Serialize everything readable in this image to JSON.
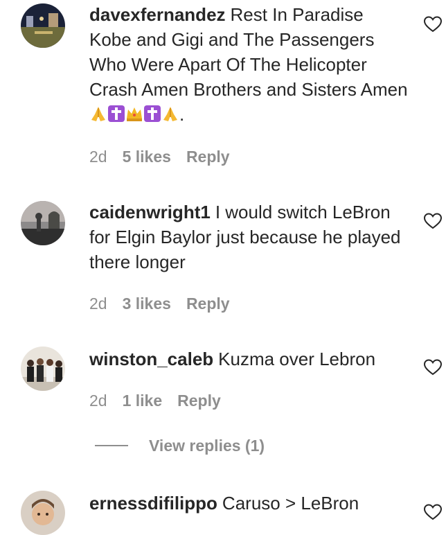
{
  "comments": [
    {
      "username": "davexfernandez",
      "text": "Rest In Paradise Kobe and Gigi and The Passengers Who Were Apart Of The Helicopter Crash Amen Brothers and Sisters Amen",
      "emoji_suffix": [
        "folded-hands",
        "latin-cross",
        "crown",
        "latin-cross",
        "folded-hands"
      ],
      "text_end": ".",
      "time": "2d",
      "likes": "5 likes",
      "reply": "Reply"
    },
    {
      "username": "caidenwright1",
      "text": "I would switch LeBron for Elgin Baylor just because he played there longer",
      "time": "2d",
      "likes": "3 likes",
      "reply": "Reply"
    },
    {
      "username": "winston_caleb",
      "text": "Kuzma over Lebron",
      "time": "2d",
      "likes": "1 like",
      "reply": "Reply",
      "view_replies": "View replies (1)"
    },
    {
      "username": "ernessdifilippo",
      "text": "Caruso > LeBron"
    }
  ],
  "colors": {
    "text": "#262626",
    "secondary": "#8e8e8e",
    "background": "#ffffff"
  },
  "icons": {
    "like": "heart-outline-icon"
  }
}
